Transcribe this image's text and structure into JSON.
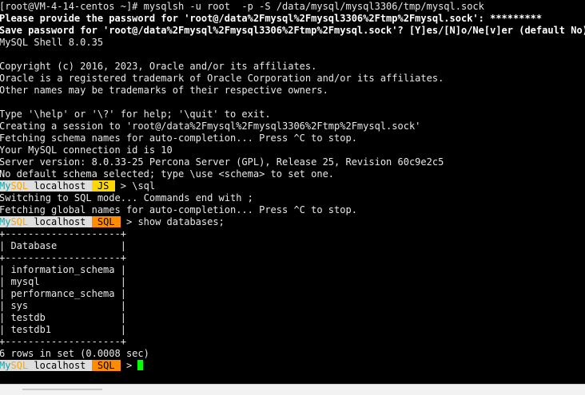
{
  "terminal": {
    "lines": [
      "[root@VM-4-14-centos ~]# mysqlsh -u root  -p -S /data/mysql/mysql3306/tmp/mysql.sock",
      "Please provide the password for 'root@/data%2Fmysql%2Fmysql3306%2Ftmp%2Fmysql.sock': *********",
      "Save password for 'root@/data%2Fmysql%2Fmysql3306%2Ftmp%2Fmysql.sock'? [Y]es/[N]o/Ne[v]er (default No):",
      "MySQL Shell 8.0.35",
      "",
      "Copyright (c) 2016, 2023, Oracle and/or its affiliates.",
      "Oracle is a registered trademark of Oracle Corporation and/or its affiliates.",
      "Other names may be trademarks of their respective owners.",
      "",
      "Type '\\help' or '\\?' for help; '\\quit' to exit.",
      "Creating a session to 'root@/data%2Fmysql%2Fmysql3306%2Ftmp%2Fmysql.sock'",
      "Fetching schema names for auto-completion... Press ^C to stop.",
      "Your MySQL connection id is 10",
      "Server version: 8.0.33-25 Percona Server (GPL), Release 25, Revision 60c9e2c5",
      "No default schema selected; type \\use <schema> to set one."
    ],
    "prompt1": {
      "my": "My",
      "sql": "SQL",
      "host": " localhost ",
      "mode": " JS ",
      "arrow": " > ",
      "command": "\\sql"
    },
    "lines2": [
      "Switching to SQL mode... Commands end with ;",
      "Fetching global names for auto-completion... Press ^C to stop."
    ],
    "prompt2": {
      "my": "My",
      "sql": "SQL",
      "host": " localhost ",
      "mode": " SQL ",
      "arrow": " > ",
      "command": "show databases;"
    },
    "table": {
      "border": "+--------------------+",
      "header": "| Database           |",
      "rows": [
        "| information_schema |",
        "| mysql              |",
        "| performance_schema |",
        "| sys                |",
        "| testdb             |",
        "| testdb1            |"
      ]
    },
    "result": "6 rows in set (0.0008 sec)",
    "prompt3": {
      "my": "My",
      "sql": "SQL",
      "host": " localhost ",
      "mode": " SQL ",
      "arrow": " > "
    },
    "colors": {
      "background": "#000000",
      "text": "#e8e8e8",
      "prompt_host_bg": "#dedede",
      "prompt_js_bg": "#ffd700",
      "prompt_sql_bg": "#ff8c00",
      "cursor": "#00ff00"
    }
  }
}
